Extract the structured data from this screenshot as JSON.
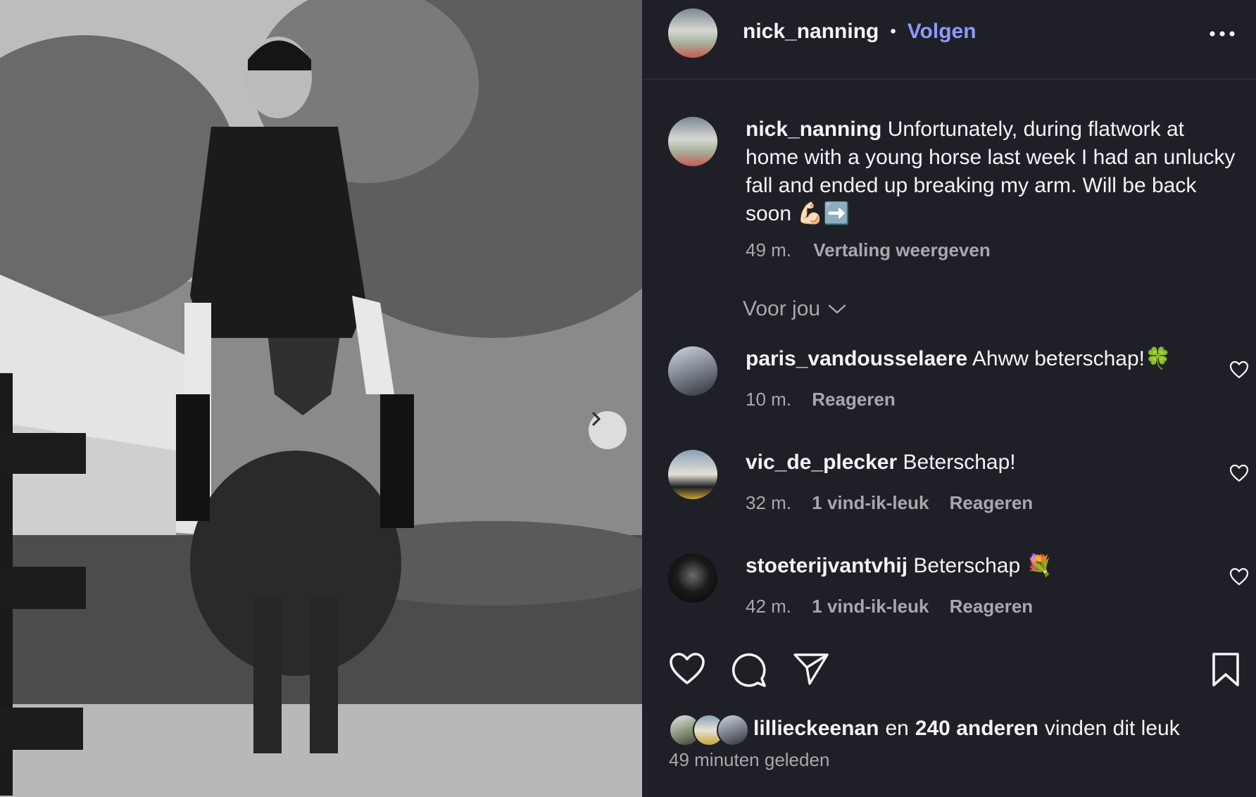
{
  "post": {
    "author": "nick_nanning",
    "follow_label": "Volgen",
    "separator": "•",
    "caption": "Unfortunately, during flatwork at home with a young horse last week I had an unlucky fall and ended up breaking my arm. Will be back soon 💪🏻➡️",
    "caption_time": "49 m.",
    "translate_label": "Vertaling weergeven",
    "filter_label": "Voor jou",
    "likes": {
      "first_liker": "lillieckeenan",
      "connector": "en",
      "others": "240 anderen",
      "suffix": "vinden dit leuk"
    },
    "posted_ago": "49 minuten geleden"
  },
  "comments": [
    {
      "user": "paris_vandousselaere",
      "text": "Ahww beterschap!🍀",
      "time": "10 m.",
      "likes": "",
      "reply": "Reageren"
    },
    {
      "user": "vic_de_plecker",
      "text": "Beterschap!",
      "time": "32 m.",
      "likes": "1 vind-ik-leuk",
      "reply": "Reageren"
    },
    {
      "user": "stoeterijvantvhij",
      "text": "Beterschap 💐",
      "time": "42 m.",
      "likes": "1 vind-ik-leuk",
      "reply": "Reageren"
    }
  ],
  "icons": {
    "next": "chevron-right-icon",
    "more": "more-horizontal-icon",
    "like": "heart-icon",
    "comment": "comment-icon",
    "share": "send-icon",
    "save": "bookmark-icon",
    "expand": "chevron-down-icon"
  },
  "colors": {
    "panel_bg": "#1f2027",
    "follow_blue": "#8c9aff",
    "muted_text": "#a8a8ad"
  }
}
